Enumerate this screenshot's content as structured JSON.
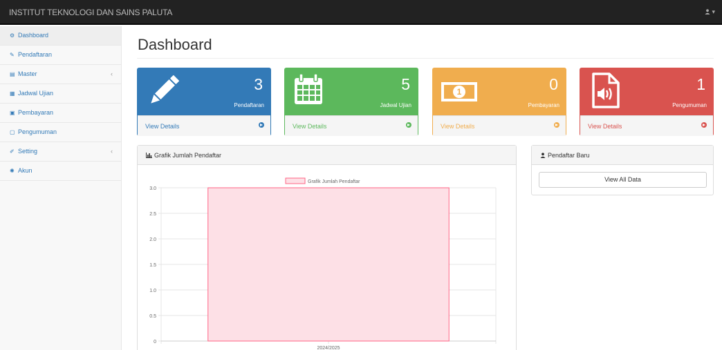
{
  "app": {
    "brand": "INSTITUT TEKNOLOGI DAN SAINS PALUTA",
    "user_icon": "user-icon",
    "user_caret": "▾"
  },
  "sidebar": {
    "items": [
      {
        "label": "Dashboard",
        "icon": "dashboard-icon",
        "active": true
      },
      {
        "label": "Pendaftaran",
        "icon": "pencil-icon"
      },
      {
        "label": "Master",
        "icon": "table-icon",
        "chevron": "‹"
      },
      {
        "label": "Jadwal Ujian",
        "icon": "calendar-icon"
      },
      {
        "label": "Pembayaran",
        "icon": "money-icon"
      },
      {
        "label": "Pengumuman",
        "icon": "file-audio-icon"
      },
      {
        "label": "Setting",
        "icon": "wrench-icon",
        "chevron": "‹"
      },
      {
        "label": "Akun",
        "icon": "gear-icon"
      }
    ]
  },
  "main": {
    "title": "Dashboard",
    "cards": [
      {
        "count": "3",
        "label": "Pendaftaran",
        "link": "View Details",
        "icon": "pencil-icon",
        "color": "#337ab7",
        "text_color": "#337ab7"
      },
      {
        "count": "5",
        "label": "Jadwal Ujian",
        "link": "View Details",
        "icon": "calendar-icon",
        "color": "#5cb85c",
        "text_color": "#5cb85c"
      },
      {
        "count": "0",
        "label": "Pembayaran",
        "link": "View Details",
        "icon": "money-icon",
        "color": "#f0ad4e",
        "text_color": "#f0ad4e"
      },
      {
        "count": "1",
        "label": "Pengumuman",
        "link": "View Details",
        "icon": "file-audio-icon",
        "color": "#d9534f",
        "text_color": "#d9534f"
      }
    ],
    "chart_panel": {
      "title": "Grafik Jumlah Pendaftar",
      "icon": "bar-chart-icon"
    },
    "new_panel": {
      "title": "Pendaftar Baru",
      "icon": "user-icon",
      "button": "View All Data"
    }
  },
  "chart_data": {
    "type": "bar",
    "categories": [
      "2024/2025"
    ],
    "series": [
      {
        "name": "Grafik Jumlah Pendaftar",
        "values": [
          3
        ]
      }
    ],
    "ylim": [
      0,
      3
    ],
    "yticks": [
      "0",
      "0.5",
      "1.0",
      "1.5",
      "2.0",
      "2.5",
      "3.0"
    ],
    "grid": true,
    "legend": "top",
    "fill_color": "#fde0e6",
    "border_color": "#ff6384"
  }
}
